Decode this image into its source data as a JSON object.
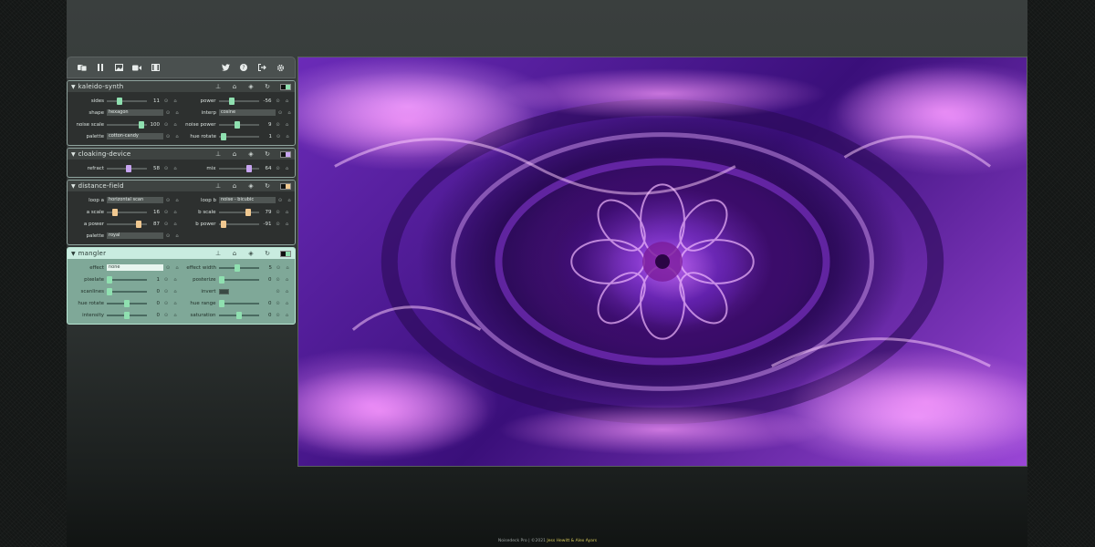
{
  "colors": {
    "accent_green": "#8fe0b0",
    "accent_tan": "#f0c890",
    "accent_purple": "#c7a4f0",
    "accent_lavender": "#b59be8"
  },
  "toolbar": {
    "left_icons": [
      "shuffle-icon",
      "pause-icon",
      "image-icon",
      "video-icon",
      "film-icon"
    ],
    "right_icons": [
      "twitter-icon",
      "help-icon",
      "sign-out-icon",
      "settings-icon"
    ]
  },
  "modules": [
    {
      "title": "kaleido-synth",
      "rows": [
        [
          {
            "label": "sides",
            "kind": "slider",
            "value": "11",
            "frac": 0.3
          },
          {
            "label": "power",
            "kind": "slider",
            "value": "-56",
            "frac": 0.3
          }
        ],
        [
          {
            "label": "shape",
            "kind": "select",
            "value": "hexagon"
          },
          {
            "label": "interp",
            "kind": "select",
            "value": "cosine"
          }
        ],
        [
          {
            "label": "noise scale",
            "kind": "slider",
            "value": "100",
            "frac": 0.92
          },
          {
            "label": "noise power",
            "kind": "slider",
            "value": "9",
            "frac": 0.45
          }
        ],
        [
          {
            "label": "palette",
            "kind": "select",
            "value": "cotton-candy"
          },
          {
            "label": "hue rotate",
            "kind": "slider",
            "value": "1",
            "frac": 0.05
          }
        ]
      ]
    },
    {
      "title": "cloaking-device",
      "rows": [
        [
          {
            "label": "refract",
            "kind": "slider",
            "value": "58",
            "frac": 0.55
          },
          {
            "label": "mix",
            "kind": "slider",
            "value": "64",
            "frac": 0.8
          }
        ]
      ]
    },
    {
      "title": "distance-field",
      "rows": [
        [
          {
            "label": "loop a",
            "kind": "select",
            "value": "horizontal scan"
          },
          {
            "label": "loop b",
            "kind": "select",
            "value": "noise - bicubic"
          }
        ],
        [
          {
            "label": "a scale",
            "kind": "slider",
            "value": "16",
            "frac": 0.15
          },
          {
            "label": "b scale",
            "kind": "slider",
            "value": "79",
            "frac": 0.75
          }
        ],
        [
          {
            "label": "a power",
            "kind": "slider",
            "value": "87",
            "frac": 0.85
          },
          {
            "label": "b power",
            "kind": "slider",
            "value": "-91",
            "frac": 0.05
          }
        ],
        [
          {
            "label": "palette",
            "kind": "select",
            "value": "royal"
          }
        ]
      ]
    },
    {
      "title": "mangler",
      "rows": [
        [
          {
            "label": "effect",
            "kind": "select",
            "value": "none"
          },
          {
            "label": "effect width",
            "kind": "slider",
            "value": "5",
            "frac": 0.45
          }
        ],
        [
          {
            "label": "pixelate",
            "kind": "slider",
            "value": "1",
            "frac": 0.0
          },
          {
            "label": "posterize",
            "kind": "slider",
            "value": "0",
            "frac": 0.0
          }
        ],
        [
          {
            "label": "scanlines",
            "kind": "slider",
            "value": "0",
            "frac": 0.0
          },
          {
            "label": "invert",
            "kind": "toggle"
          }
        ],
        [
          {
            "label": "hue rotate",
            "kind": "slider",
            "value": "0",
            "frac": 0.5
          },
          {
            "label": "hue range",
            "kind": "slider",
            "value": "0",
            "frac": 0.0
          }
        ],
        [
          {
            "label": "intensity",
            "kind": "slider",
            "value": "0",
            "frac": 0.5
          },
          {
            "label": "saturation",
            "kind": "slider",
            "value": "0",
            "frac": 0.5
          }
        ]
      ]
    }
  ],
  "footer": {
    "prefix": "Noisedeck Pro | ©2021",
    "author1": "Jess Hewitt",
    "sep": "&",
    "author2": "Alex Ayars"
  }
}
